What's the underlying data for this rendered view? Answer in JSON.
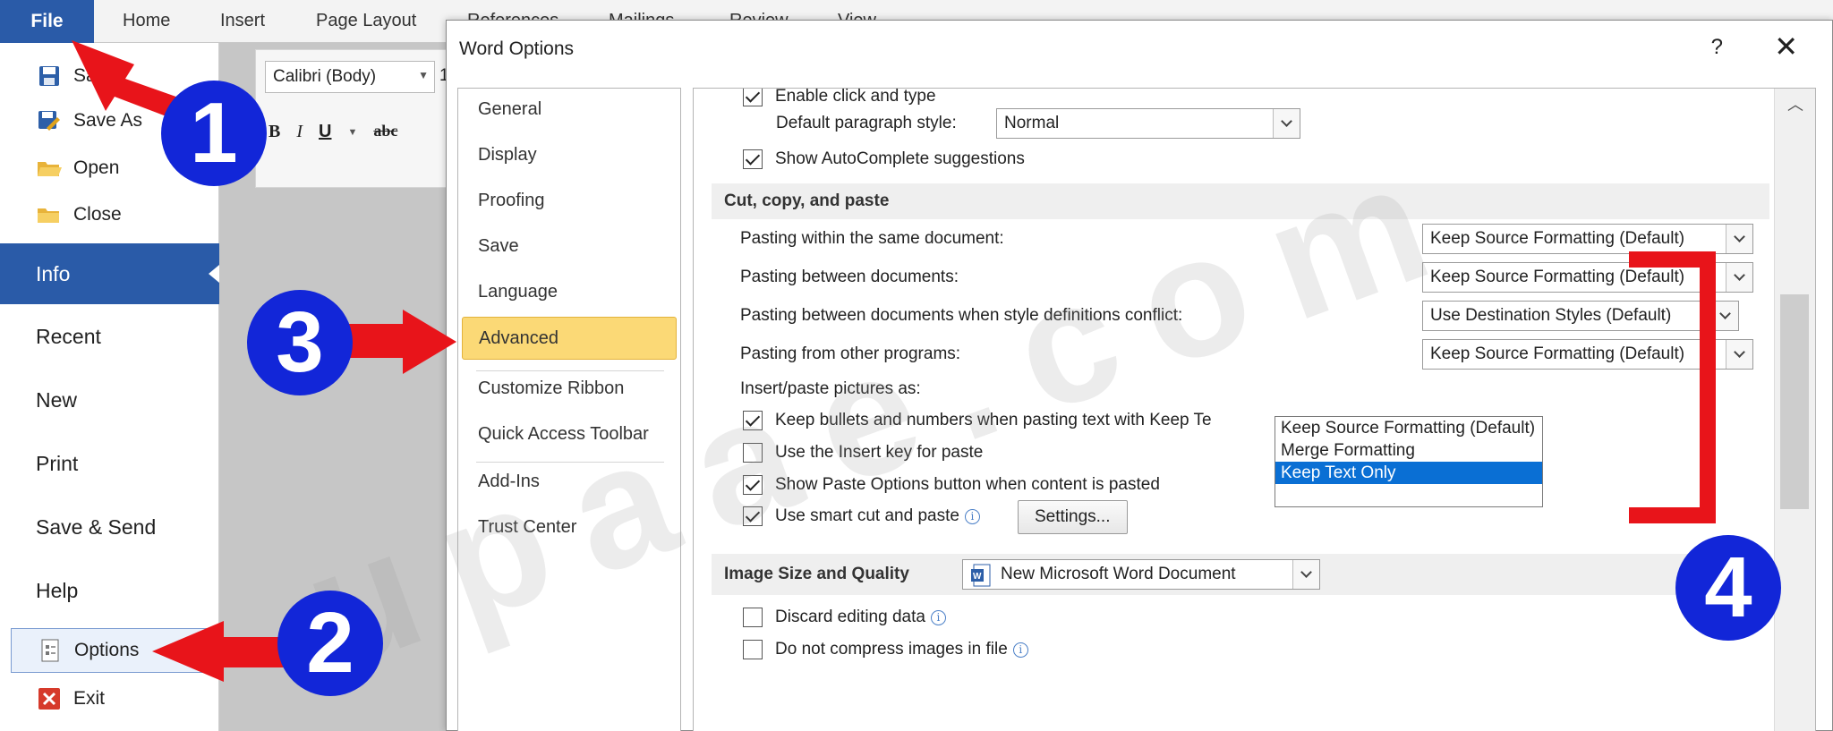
{
  "ribbon": {
    "file_tab": "File",
    "tabs": [
      "Home",
      "Insert",
      "Page Layout",
      "References",
      "Mailings",
      "Review",
      "View"
    ]
  },
  "backstage": {
    "commands_top": [
      {
        "label": "Save",
        "icon": "floppy-disk-icon"
      },
      {
        "label": "Save As",
        "icon": "save-as-icon"
      },
      {
        "label": "Open",
        "icon": "open-folder-icon"
      },
      {
        "label": "Close",
        "icon": "close-folder-icon"
      }
    ],
    "tabs": [
      {
        "label": "Info",
        "selected": true
      },
      {
        "label": "Recent"
      },
      {
        "label": "New"
      },
      {
        "label": "Print"
      },
      {
        "label": "Save & Send"
      },
      {
        "label": "Help"
      }
    ],
    "options_label": "Options",
    "exit_label": "Exit"
  },
  "font_bar": {
    "font_name": "Calibri (Body)",
    "font_size": "1",
    "bold": "B",
    "italic": "I",
    "underline": "U",
    "strike": "abc"
  },
  "dialog": {
    "title": "Word Options",
    "help": "?",
    "close": "✕",
    "nav": [
      "General",
      "Display",
      "Proofing",
      "Save",
      "Language",
      "Advanced",
      "Customize Ribbon",
      "Quick Access Toolbar",
      "Add-Ins",
      "Trust Center"
    ],
    "active_nav": "Advanced",
    "editing": {
      "click_and_type": "Enable click and type",
      "default_style_label": "Default paragraph style:",
      "default_style_value": "Normal",
      "autocomplete": "Show AutoComplete suggestions"
    },
    "cut_copy_paste": {
      "header": "Cut, copy, and paste",
      "rows": [
        {
          "label": "Pasting within the same document:",
          "value": "Keep Source Formatting (Default)"
        },
        {
          "label": "Pasting between documents:",
          "value": "Keep Source Formatting (Default)"
        },
        {
          "label": "Pasting between documents when style definitions conflict:",
          "value": "Use Destination Styles (Default)"
        },
        {
          "label": "Pasting from other programs:",
          "value": "Keep Source Formatting (Default)"
        }
      ],
      "insert_pictures_label": "Insert/paste pictures as:",
      "dropdown_options": [
        "Keep Source Formatting (Default)",
        "Merge Formatting",
        "Keep Text Only"
      ],
      "dropdown_selected": "Keep Text Only",
      "keep_bullets": "Keep bullets and numbers when pasting text with Keep Te",
      "insert_key": "Use the Insert key for paste",
      "paste_options": "Show Paste Options button when content is pasted",
      "smart_cut": "Use smart cut and paste",
      "settings_button": "Settings..."
    },
    "image_quality": {
      "header": "Image Size and Quality",
      "document": "New Microsoft Word Document",
      "discard": "Discard editing data",
      "no_compress": "Do not compress images in file"
    }
  },
  "annotations": {
    "steps": [
      "1",
      "2",
      "3",
      "4"
    ],
    "watermark": "upaae.com",
    "colors": {
      "arrow": "#e8141a",
      "badge": "#1226d8",
      "bracket": "#e8141a"
    }
  }
}
